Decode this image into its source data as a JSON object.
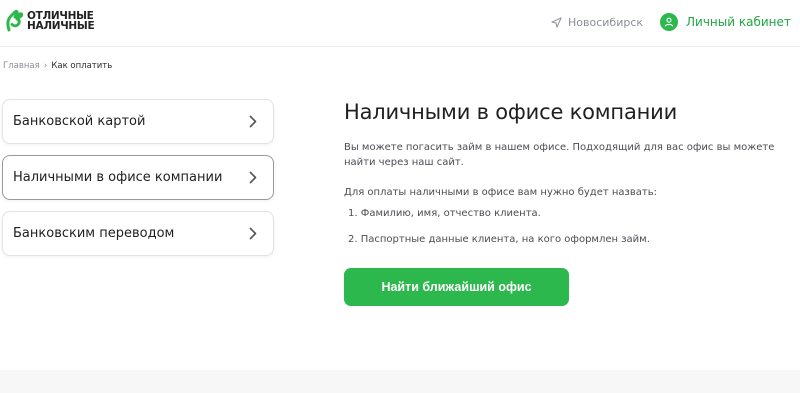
{
  "header": {
    "logo_line1": "ОТЛИЧНЫЕ",
    "logo_line2": "НАЛИЧНЫЕ",
    "city": "Новосибирск",
    "account_label": "Личный кабинет"
  },
  "breadcrumb": {
    "home": "Главная",
    "separator": "›",
    "current": "Как оплатить"
  },
  "methods": [
    {
      "label": "Банковской картой",
      "active": false
    },
    {
      "label": "Наличными в офисе компании",
      "active": true
    },
    {
      "label": "Банковским переводом",
      "active": false
    }
  ],
  "content": {
    "title": "Наличными в офисе компании",
    "intro": "Вы можете погасить займ в нашем офисе. Подходящий для вас офис вы можете найти через наш сайт.",
    "requirements_lead": "Для оплаты наличными в офисе вам нужно будет назвать:",
    "requirements": [
      "1. Фамилию, имя, отчество клиента.",
      "2. Паспортные данные клиента, на кого оформлен займ."
    ],
    "cta_label": "Найти ближайший офис"
  },
  "colors": {
    "brand_green": "#2db84e",
    "account_text": "#1fa644",
    "muted_text": "#8a8f96"
  },
  "icons": {
    "logo": "brand-hand-icon",
    "city": "location-arrow-icon",
    "account": "user-icon",
    "method_chevron": "chevron-right-icon"
  }
}
